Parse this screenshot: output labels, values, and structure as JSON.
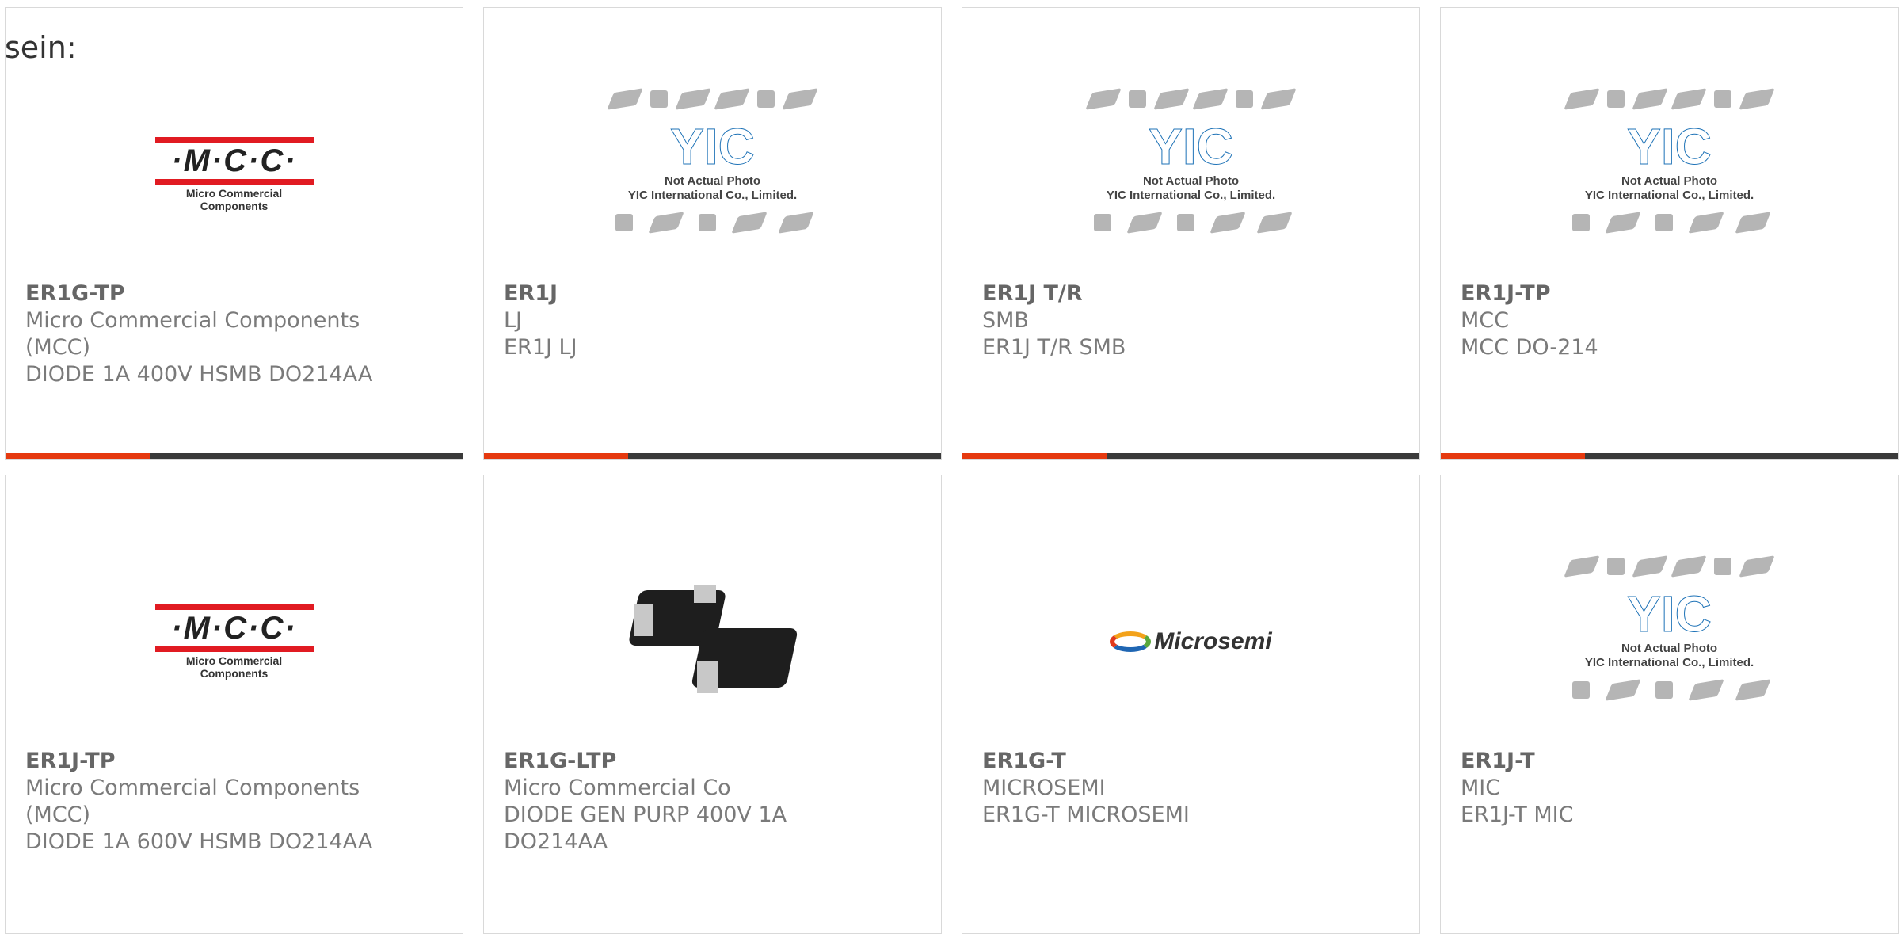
{
  "page": {
    "lead_text": "sein:"
  },
  "colors": {
    "accent": "#e5390f",
    "bar": "#3a3a3a",
    "border": "#d9d9d9",
    "text": "#7a7a7a"
  },
  "logos": {
    "mcc_text": "·M·C·C·",
    "mcc_subtitle": "Micro Commercial Components",
    "yic_mark": "YIC",
    "yic_note_line1": "Not Actual Photo",
    "yic_note_line2": "YIC International Co., Limited.",
    "microsemi_text": "Microsemi"
  },
  "products": [
    {
      "part": "ER1G-TP",
      "lines": [
        "Micro Commercial Components",
        "(MCC)",
        "DIODE 1A 400V HSMB DO214AA"
      ],
      "image": "mcc-logo"
    },
    {
      "part": "ER1J",
      "lines": [
        "LJ",
        "ER1J LJ"
      ],
      "image": "yic-placeholder"
    },
    {
      "part": "ER1J T/R",
      "lines": [
        "SMB",
        "ER1J T/R SMB"
      ],
      "image": "yic-placeholder"
    },
    {
      "part": "ER1J-TP",
      "lines": [
        "MCC",
        "MCC DO-214"
      ],
      "image": "yic-placeholder"
    },
    {
      "part": "ER1J-TP",
      "lines": [
        "Micro Commercial Components",
        "(MCC)",
        "DIODE 1A 600V HSMB DO214AA"
      ],
      "image": "mcc-logo"
    },
    {
      "part": "ER1G-LTP",
      "lines": [
        "Micro Commercial Co",
        "DIODE GEN PURP 400V 1A",
        "DO214AA"
      ],
      "image": "diode-photo"
    },
    {
      "part": "ER1G-T",
      "lines": [
        "MICROSEMI",
        "ER1G-T MICROSEMI"
      ],
      "image": "microsemi-logo"
    },
    {
      "part": "ER1J-T",
      "lines": [
        "MIC",
        "ER1J-T MIC"
      ],
      "image": "yic-placeholder"
    }
  ]
}
